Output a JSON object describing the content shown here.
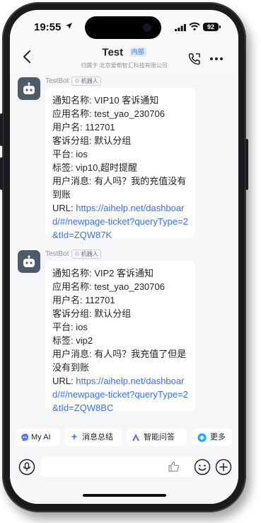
{
  "status_bar": {
    "time": "19:55",
    "battery": "92"
  },
  "header": {
    "title": "Test",
    "badge": "内部",
    "subtitle": "归属于 北京爱帮智汇科技有限公司",
    "icons": [
      "back-icon",
      "call-icon",
      "more-icon"
    ]
  },
  "messages": [
    {
      "sender": "TestBot",
      "sender_tag": "机器人",
      "lines": [
        "通知名称: VIP10 客诉通知",
        "应用名称: test_yao_230706",
        "用户名: 112701",
        "客诉分组: 默认分组",
        "平台: ios",
        "标签: vip10,超时提醒"
      ],
      "user_message": "用户消息: 有人吗？我的充值没有到账",
      "url_label": "URL: ",
      "url": "https://aihelp.net/dashboard/#/newpage-ticket?queryType=2&tId=ZQW87K"
    },
    {
      "sender": "TestBot",
      "sender_tag": "机器人",
      "lines": [
        "通知名称: VIP2 客诉通知",
        "应用名称: test_yao_230706",
        "用户名: 112701",
        "客诉分组: 默认分组",
        "平台: ios",
        "标签: vip2"
      ],
      "user_message": "用户消息: 有人吗？我充值了但是没有到账",
      "url_label": "URL: ",
      "url": "https://aihelp.net/dashboard/#/newpage-ticket?queryType=2&tId=ZQW8BC"
    }
  ],
  "quick_actions": [
    {
      "label": "My AI",
      "icon": "my-ai-icon"
    },
    {
      "label": "消息总结",
      "icon": "summary-icon"
    },
    {
      "label": "智能问答",
      "icon": "qa-icon"
    },
    {
      "label": "更多",
      "icon": "more-apps-icon"
    }
  ],
  "composer": {
    "icons": [
      "mic-icon",
      "thumbs-up-icon",
      "emoji-icon",
      "plus-icon"
    ]
  },
  "colors": {
    "link": "#3370ff",
    "avatar": "#4e5969",
    "background": "#f5f6f7"
  }
}
